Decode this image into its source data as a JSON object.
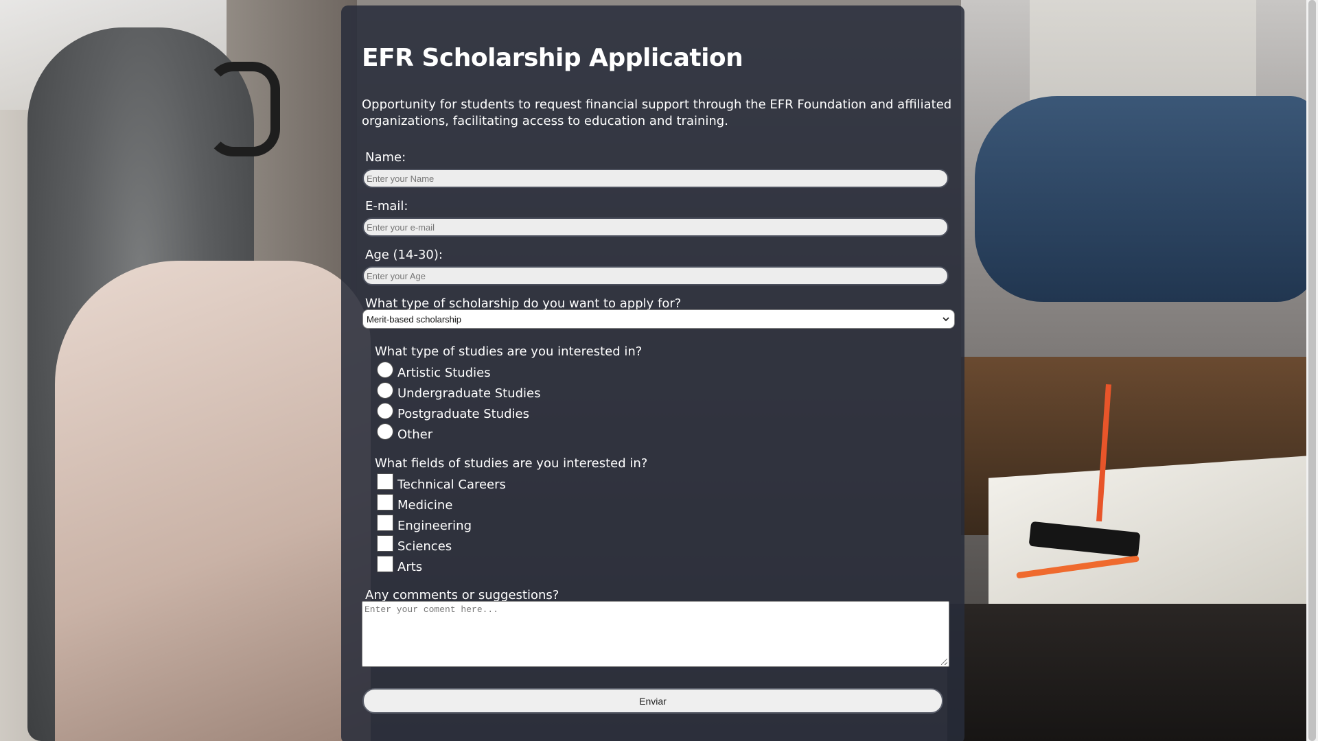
{
  "form": {
    "title": "EFR Scholarship Application",
    "description": "Opportunity for students to request financial support through the EFR Foundation and affiliated organizations, facilitating access to education and training.",
    "name": {
      "label": "Name:",
      "placeholder": "Enter your Name",
      "value": ""
    },
    "email": {
      "label": "E-mail:",
      "placeholder": "Enter your e-mail",
      "value": ""
    },
    "age": {
      "label": "Age (14-30):",
      "placeholder": "Enter your Age",
      "value": ""
    },
    "scholarship_type": {
      "label": "What type of scholarship do you want to apply for?",
      "selected": "Merit-based scholarship"
    },
    "study_type": {
      "label": "What type of studies are you interested in?",
      "options": [
        "Artistic Studies",
        "Undergraduate Studies",
        "Postgraduate Studies",
        "Other"
      ]
    },
    "study_fields": {
      "label": "What fields of studies are you interested in?",
      "options": [
        "Technical Careers",
        "Medicine",
        "Engineering",
        "Sciences",
        "Arts"
      ]
    },
    "comments": {
      "label": "Any comments or suggestions?",
      "placeholder": "Enter your coment here..."
    },
    "submit_label": "Enviar"
  },
  "icons": {
    "select_arrow": "chevron-down-icon"
  },
  "colors": {
    "panel_background": "#282c3a",
    "input_background": "#ededed",
    "text": "#ffffff"
  }
}
